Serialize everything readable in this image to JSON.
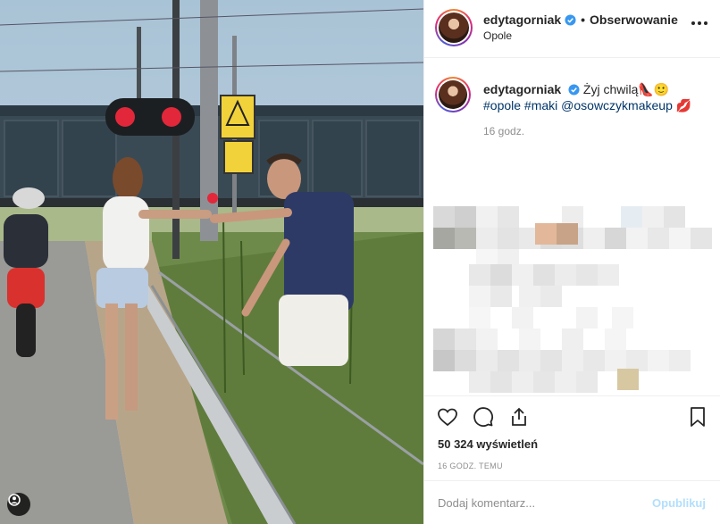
{
  "post": {
    "username": "edytagorniak",
    "separator": "•",
    "follow_label": "Obserwowanie",
    "location": "Opole",
    "caption_user": "edytagorniak",
    "caption_text": "Żyj chwilą",
    "caption_emoji": "👠🙂",
    "hashtags": "#opole #maki @osowczykmakeup",
    "hashtag_emoji": "💋",
    "age": "16 godz.",
    "views_count": "50 324",
    "views_label": "wyświetleń",
    "timestamp": "16 GODZ. TEMU"
  },
  "comment": {
    "placeholder": "Dodaj komentarz...",
    "publish_label": "Opublikuj"
  },
  "colors": {
    "link": "#003569",
    "verified": "#3897f0",
    "publish_disabled": "#b2dffc",
    "muted": "#8e8e8e"
  },
  "icons": [
    "more-icon",
    "verified-icon",
    "heart-icon",
    "comment-icon",
    "share-icon",
    "bookmark-icon",
    "media-badge-icon"
  ]
}
